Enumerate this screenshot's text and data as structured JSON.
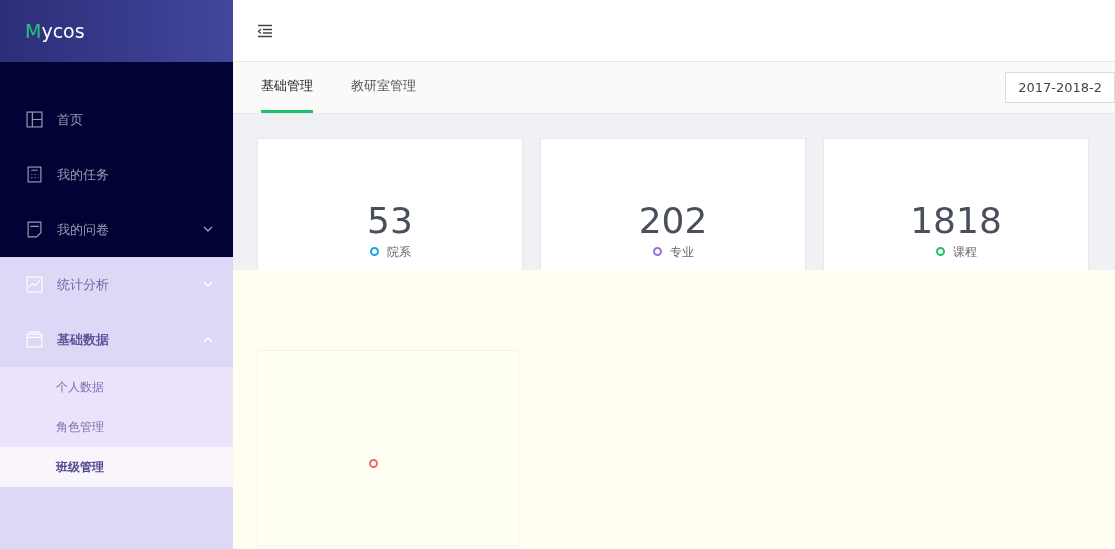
{
  "brand": {
    "initial": "M",
    "rest": "ycos"
  },
  "sidebar": {
    "items": [
      {
        "label": "首页",
        "kind": "link"
      },
      {
        "label": "我的任务",
        "kind": "link"
      },
      {
        "label": "我的问卷",
        "kind": "group",
        "expanded": false
      },
      {
        "label": "统计分析",
        "kind": "group",
        "expanded": false
      },
      {
        "label": "基础数据",
        "kind": "group",
        "expanded": true,
        "children": [
          {
            "label": "个人数据",
            "selected": false
          },
          {
            "label": "角色管理",
            "selected": false
          },
          {
            "label": "班级管理",
            "selected": true
          }
        ]
      }
    ]
  },
  "tabs": [
    {
      "label": "基础管理",
      "selected": true
    },
    {
      "label": "教研室管理",
      "selected": false
    }
  ],
  "term_select": {
    "value": "2017-2018-2"
  },
  "stats": [
    {
      "value": "53",
      "label": "院系",
      "color": "#1aa3e8"
    },
    {
      "value": "202",
      "label": "专业",
      "color": "#9b6ee0"
    },
    {
      "value": "1818",
      "label": "课程",
      "color": "#1fc16b"
    }
  ],
  "faded_card": {
    "color": "#f06a6a"
  }
}
